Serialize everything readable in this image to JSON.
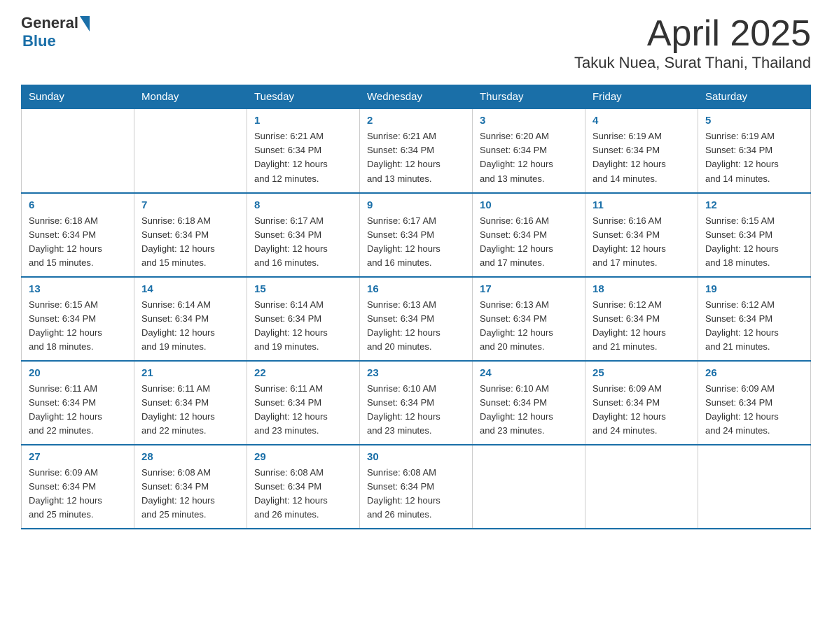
{
  "header": {
    "logo_general": "General",
    "logo_blue": "Blue",
    "title": "April 2025",
    "location": "Takuk Nuea, Surat Thani, Thailand"
  },
  "days_of_week": [
    "Sunday",
    "Monday",
    "Tuesday",
    "Wednesday",
    "Thursday",
    "Friday",
    "Saturday"
  ],
  "weeks": [
    [
      {
        "day": "",
        "info": []
      },
      {
        "day": "",
        "info": []
      },
      {
        "day": "1",
        "info": [
          "Sunrise: 6:21 AM",
          "Sunset: 6:34 PM",
          "Daylight: 12 hours",
          "and 12 minutes."
        ]
      },
      {
        "day": "2",
        "info": [
          "Sunrise: 6:21 AM",
          "Sunset: 6:34 PM",
          "Daylight: 12 hours",
          "and 13 minutes."
        ]
      },
      {
        "day": "3",
        "info": [
          "Sunrise: 6:20 AM",
          "Sunset: 6:34 PM",
          "Daylight: 12 hours",
          "and 13 minutes."
        ]
      },
      {
        "day": "4",
        "info": [
          "Sunrise: 6:19 AM",
          "Sunset: 6:34 PM",
          "Daylight: 12 hours",
          "and 14 minutes."
        ]
      },
      {
        "day": "5",
        "info": [
          "Sunrise: 6:19 AM",
          "Sunset: 6:34 PM",
          "Daylight: 12 hours",
          "and 14 minutes."
        ]
      }
    ],
    [
      {
        "day": "6",
        "info": [
          "Sunrise: 6:18 AM",
          "Sunset: 6:34 PM",
          "Daylight: 12 hours",
          "and 15 minutes."
        ]
      },
      {
        "day": "7",
        "info": [
          "Sunrise: 6:18 AM",
          "Sunset: 6:34 PM",
          "Daylight: 12 hours",
          "and 15 minutes."
        ]
      },
      {
        "day": "8",
        "info": [
          "Sunrise: 6:17 AM",
          "Sunset: 6:34 PM",
          "Daylight: 12 hours",
          "and 16 minutes."
        ]
      },
      {
        "day": "9",
        "info": [
          "Sunrise: 6:17 AM",
          "Sunset: 6:34 PM",
          "Daylight: 12 hours",
          "and 16 minutes."
        ]
      },
      {
        "day": "10",
        "info": [
          "Sunrise: 6:16 AM",
          "Sunset: 6:34 PM",
          "Daylight: 12 hours",
          "and 17 minutes."
        ]
      },
      {
        "day": "11",
        "info": [
          "Sunrise: 6:16 AM",
          "Sunset: 6:34 PM",
          "Daylight: 12 hours",
          "and 17 minutes."
        ]
      },
      {
        "day": "12",
        "info": [
          "Sunrise: 6:15 AM",
          "Sunset: 6:34 PM",
          "Daylight: 12 hours",
          "and 18 minutes."
        ]
      }
    ],
    [
      {
        "day": "13",
        "info": [
          "Sunrise: 6:15 AM",
          "Sunset: 6:34 PM",
          "Daylight: 12 hours",
          "and 18 minutes."
        ]
      },
      {
        "day": "14",
        "info": [
          "Sunrise: 6:14 AM",
          "Sunset: 6:34 PM",
          "Daylight: 12 hours",
          "and 19 minutes."
        ]
      },
      {
        "day": "15",
        "info": [
          "Sunrise: 6:14 AM",
          "Sunset: 6:34 PM",
          "Daylight: 12 hours",
          "and 19 minutes."
        ]
      },
      {
        "day": "16",
        "info": [
          "Sunrise: 6:13 AM",
          "Sunset: 6:34 PM",
          "Daylight: 12 hours",
          "and 20 minutes."
        ]
      },
      {
        "day": "17",
        "info": [
          "Sunrise: 6:13 AM",
          "Sunset: 6:34 PM",
          "Daylight: 12 hours",
          "and 20 minutes."
        ]
      },
      {
        "day": "18",
        "info": [
          "Sunrise: 6:12 AM",
          "Sunset: 6:34 PM",
          "Daylight: 12 hours",
          "and 21 minutes."
        ]
      },
      {
        "day": "19",
        "info": [
          "Sunrise: 6:12 AM",
          "Sunset: 6:34 PM",
          "Daylight: 12 hours",
          "and 21 minutes."
        ]
      }
    ],
    [
      {
        "day": "20",
        "info": [
          "Sunrise: 6:11 AM",
          "Sunset: 6:34 PM",
          "Daylight: 12 hours",
          "and 22 minutes."
        ]
      },
      {
        "day": "21",
        "info": [
          "Sunrise: 6:11 AM",
          "Sunset: 6:34 PM",
          "Daylight: 12 hours",
          "and 22 minutes."
        ]
      },
      {
        "day": "22",
        "info": [
          "Sunrise: 6:11 AM",
          "Sunset: 6:34 PM",
          "Daylight: 12 hours",
          "and 23 minutes."
        ]
      },
      {
        "day": "23",
        "info": [
          "Sunrise: 6:10 AM",
          "Sunset: 6:34 PM",
          "Daylight: 12 hours",
          "and 23 minutes."
        ]
      },
      {
        "day": "24",
        "info": [
          "Sunrise: 6:10 AM",
          "Sunset: 6:34 PM",
          "Daylight: 12 hours",
          "and 23 minutes."
        ]
      },
      {
        "day": "25",
        "info": [
          "Sunrise: 6:09 AM",
          "Sunset: 6:34 PM",
          "Daylight: 12 hours",
          "and 24 minutes."
        ]
      },
      {
        "day": "26",
        "info": [
          "Sunrise: 6:09 AM",
          "Sunset: 6:34 PM",
          "Daylight: 12 hours",
          "and 24 minutes."
        ]
      }
    ],
    [
      {
        "day": "27",
        "info": [
          "Sunrise: 6:09 AM",
          "Sunset: 6:34 PM",
          "Daylight: 12 hours",
          "and 25 minutes."
        ]
      },
      {
        "day": "28",
        "info": [
          "Sunrise: 6:08 AM",
          "Sunset: 6:34 PM",
          "Daylight: 12 hours",
          "and 25 minutes."
        ]
      },
      {
        "day": "29",
        "info": [
          "Sunrise: 6:08 AM",
          "Sunset: 6:34 PM",
          "Daylight: 12 hours",
          "and 26 minutes."
        ]
      },
      {
        "day": "30",
        "info": [
          "Sunrise: 6:08 AM",
          "Sunset: 6:34 PM",
          "Daylight: 12 hours",
          "and 26 minutes."
        ]
      },
      {
        "day": "",
        "info": []
      },
      {
        "day": "",
        "info": []
      },
      {
        "day": "",
        "info": []
      }
    ]
  ]
}
